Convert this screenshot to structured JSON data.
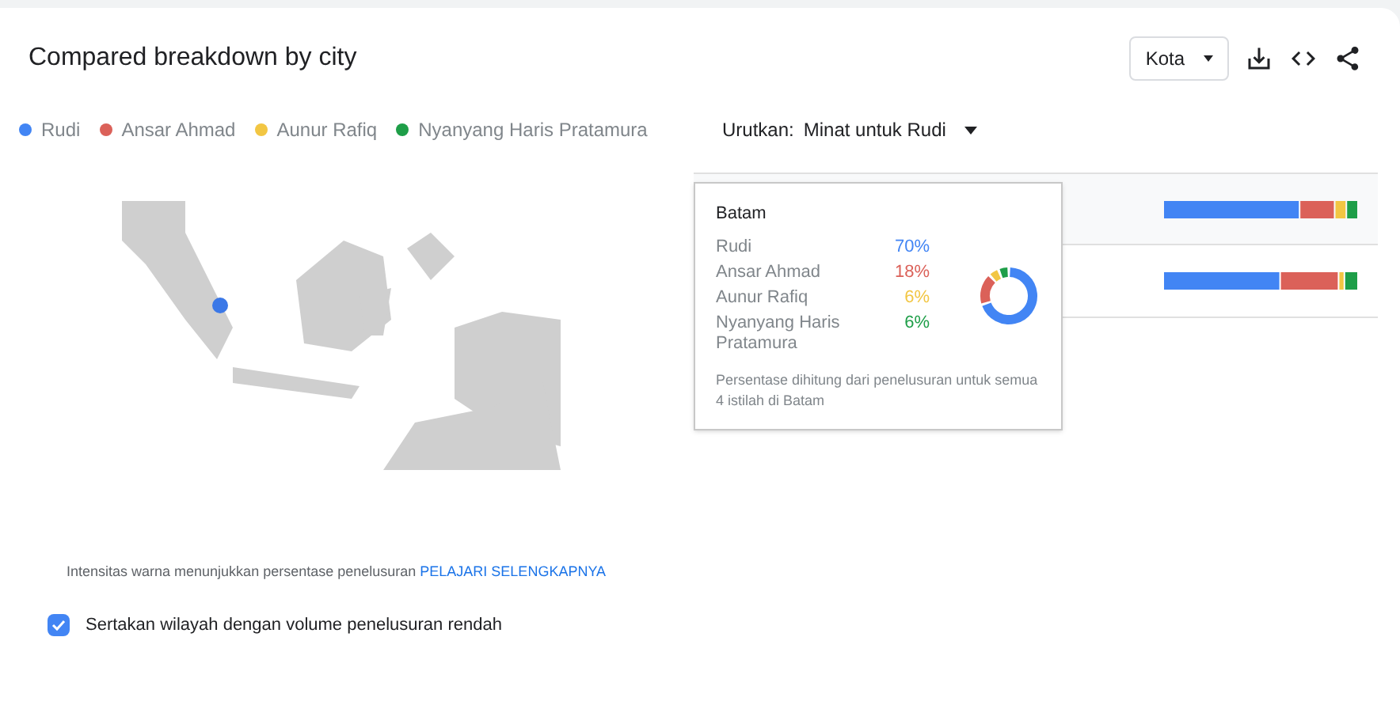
{
  "card": {
    "title": "Compared breakdown by city",
    "region_select": "Kota"
  },
  "legend": [
    {
      "name": "Rudi",
      "color": "#4285f4"
    },
    {
      "name": "Ansar Ahmad",
      "color": "#db6159"
    },
    {
      "name": "Aunur Rafiq",
      "color": "#f2c643"
    },
    {
      "name": "Nyanyang Haris Pratamura",
      "color": "#1e9e48"
    }
  ],
  "sort": {
    "label": "Urutkan:",
    "value": "Minat untuk Rudi"
  },
  "tooltip": {
    "title": "Batam",
    "entries": [
      {
        "name": "Rudi",
        "value": "70%"
      },
      {
        "name": "Ansar Ahmad",
        "value": "18%"
      },
      {
        "name": "Aunur Rafiq",
        "value": "6%"
      },
      {
        "name": "Nyanyang Haris Pratamura",
        "value": "6%"
      }
    ],
    "note": "Persentase dihitung dari penelusuran untuk semua 4 istilah di Batam"
  },
  "map_note": {
    "text": "Intensitas warna menunjukkan persentase penelusuran",
    "link": "PELAJARI SELENGKAPNYA"
  },
  "low_volume": {
    "label": "Sertakan wilayah dengan volume penelusuran rendah",
    "checked": true
  }
}
